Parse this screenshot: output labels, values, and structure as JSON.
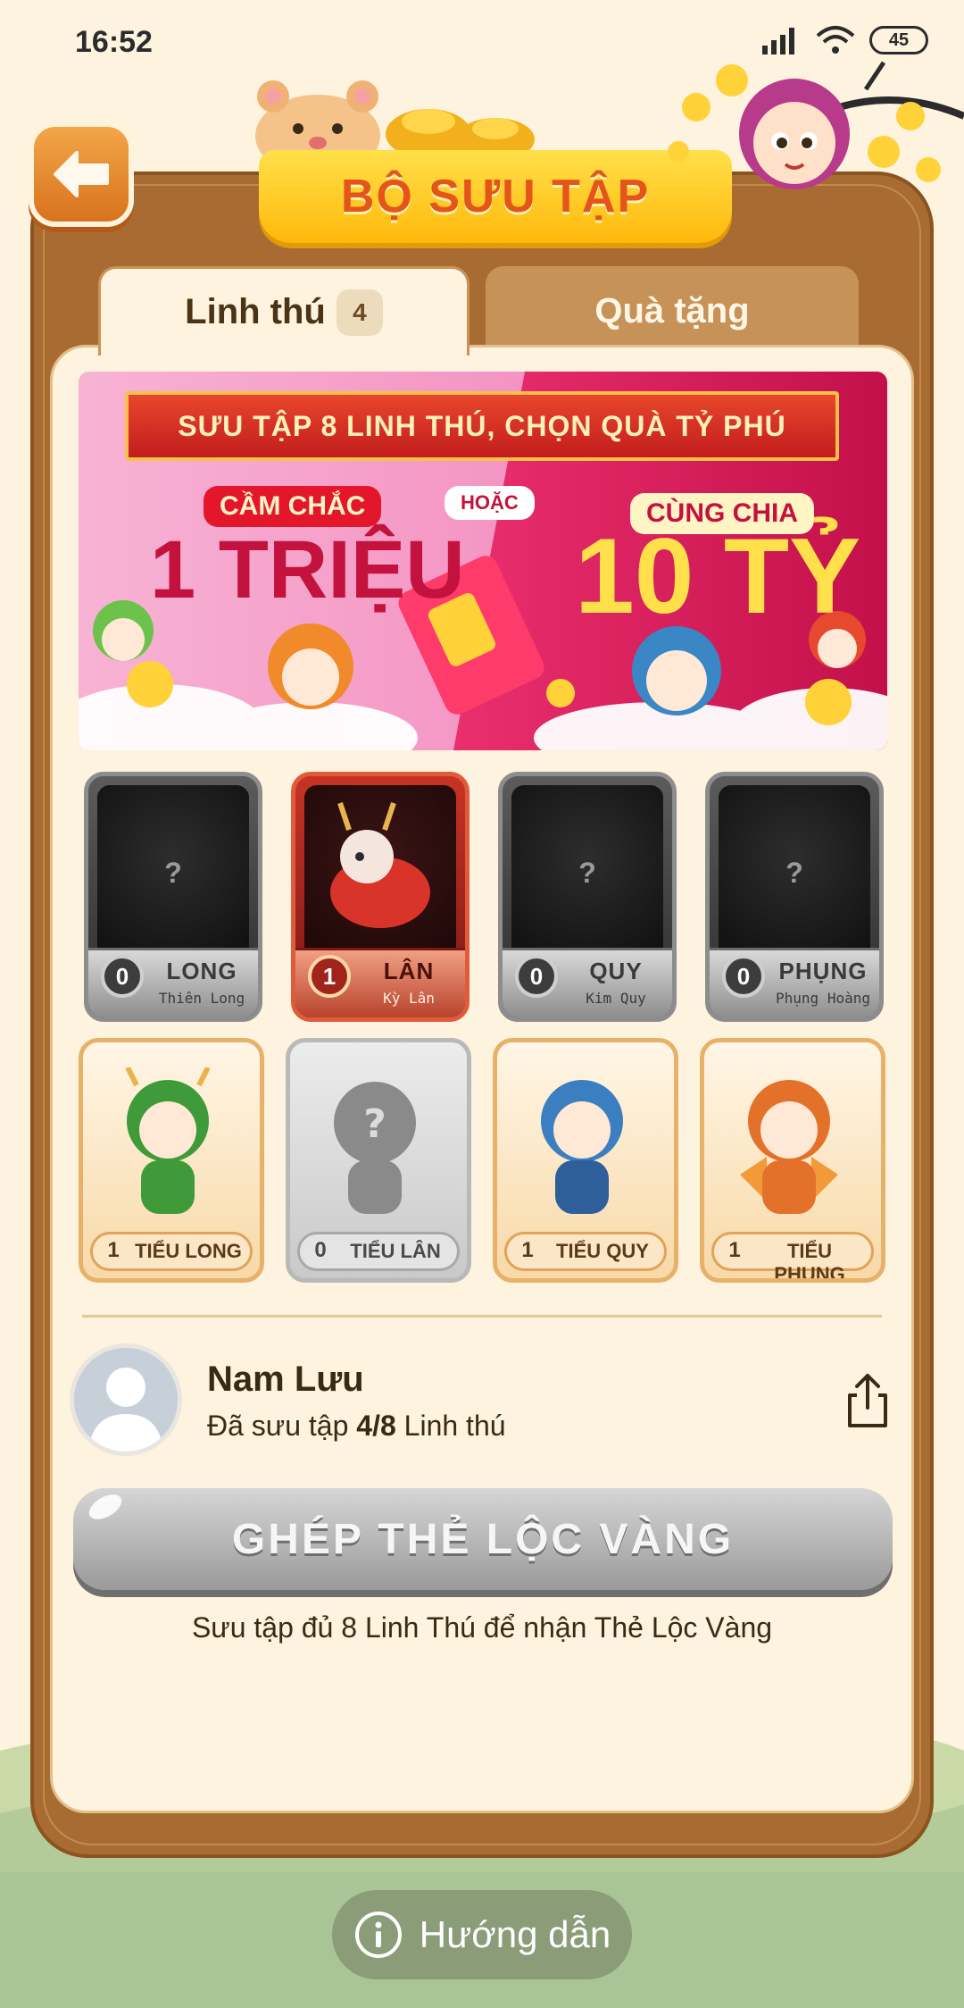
{
  "status_bar": {
    "time": "16:52",
    "battery": "45"
  },
  "header": {
    "title": "BỘ SƯU TẬP"
  },
  "tabs": [
    {
      "label": "Linh thú",
      "count": "4",
      "active": true
    },
    {
      "label": "Quà tặng",
      "active": false
    }
  ],
  "promo": {
    "ribbon": "SƯU TẬP 8 LINH THÚ, CHỌN QUÀ TỶ PHÚ",
    "left_caption": "CẦM CHẮC",
    "left_amount": "1 TRIỆU",
    "or": "HOẶC",
    "right_caption": "CÙNG CHIA",
    "right_amount": "10 TỶ"
  },
  "cards_top": [
    {
      "name": "LONG",
      "sub": "Thiên Long",
      "count": "0",
      "unlocked": false
    },
    {
      "name": "LÂN",
      "sub": "Kỳ Lân",
      "count": "1",
      "unlocked": true
    },
    {
      "name": "QUY",
      "sub": "Kim Quy",
      "count": "0",
      "unlocked": false
    },
    {
      "name": "PHỤNG",
      "sub": "Phụng Hoàng",
      "count": "0",
      "unlocked": false
    }
  ],
  "cards_bottom": [
    {
      "name": "TIỂU LONG",
      "count": "1",
      "unlocked": true,
      "color": "#3f9b3a"
    },
    {
      "name": "TIỂU LÂN",
      "count": "0",
      "unlocked": false,
      "color": "#8a8a8a"
    },
    {
      "name": "TIỂU QUY",
      "count": "1",
      "unlocked": true,
      "color": "#3b7fc0"
    },
    {
      "name": "TIỂU PHỤNG",
      "count": "1",
      "unlocked": true,
      "color": "#e3712a"
    }
  ],
  "profile": {
    "name": "Nam Lưu",
    "stat_prefix": "Đã sưu tập ",
    "stat_value": "4/8",
    "stat_suffix": " Linh thú"
  },
  "combine": {
    "label": "GHÉP THẺ LỘC VÀNG",
    "hint": "Sưu tập đủ 8 Linh Thú để nhận Thẻ Lộc Vàng"
  },
  "guide": {
    "label": "Hướng dẫn"
  },
  "colors": {
    "frame": "#a86c33",
    "title_yellow": "#ffc81a",
    "accent_orange": "#e5551a",
    "promo_pink": "#e8286a"
  }
}
